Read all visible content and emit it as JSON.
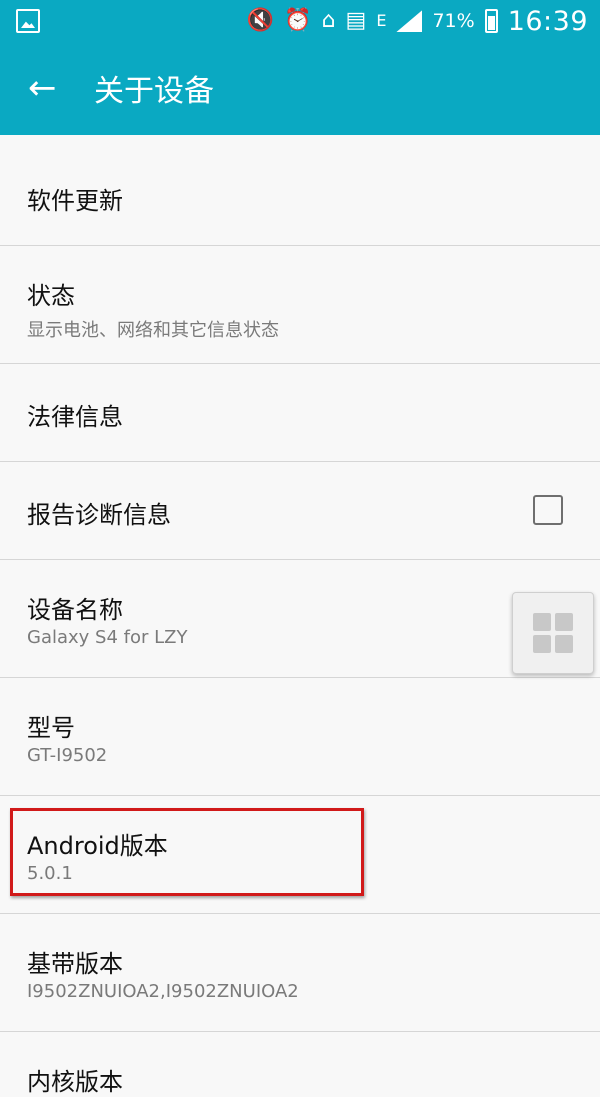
{
  "status_bar": {
    "battery_percent": "71%",
    "time": "16:39",
    "network": "E",
    "icons": [
      "gallery-icon",
      "mute-icon",
      "alarm-icon",
      "home-icon",
      "data-icon",
      "network-e-icon",
      "signal-icon",
      "battery-icon"
    ]
  },
  "app_bar": {
    "title": "关于设备",
    "back_icon": "arrow-left-icon"
  },
  "items": [
    {
      "title": "软件更新"
    },
    {
      "title": "状态",
      "subtitle": "显示电池、网络和其它信息状态"
    },
    {
      "title": "法律信息"
    },
    {
      "title": "报告诊断信息",
      "checkbox_checked": false
    },
    {
      "title": "设备名称",
      "subtitle": "Galaxy S4 for LZY"
    },
    {
      "title": "型号",
      "subtitle": "GT-I9502"
    },
    {
      "title": "Android版本",
      "subtitle": "5.0.1"
    },
    {
      "title": "基带版本",
      "subtitle": "I9502ZNUIOA2,I9502ZNUIOA2"
    },
    {
      "title": "内核版本"
    }
  ],
  "colors": {
    "primary": "#0aa9c2",
    "highlight": "#d11a1a"
  }
}
